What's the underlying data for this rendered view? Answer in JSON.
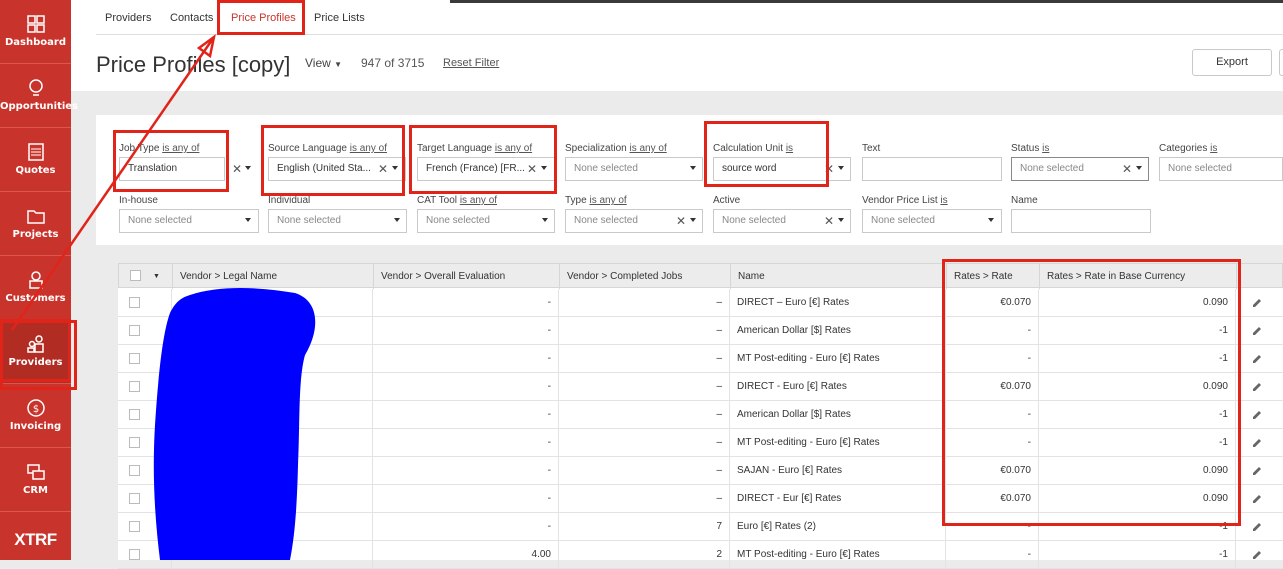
{
  "nav": {
    "items": [
      {
        "label": "Dashboard",
        "icon": "dashboard-icon"
      },
      {
        "label": "Opportunities",
        "icon": "lightbulb-icon"
      },
      {
        "label": "Quotes",
        "icon": "calculator-icon"
      },
      {
        "label": "Projects",
        "icon": "folder-icon"
      },
      {
        "label": "Customers",
        "icon": "customer-icon"
      },
      {
        "label": "Providers",
        "icon": "providers-icon"
      },
      {
        "label": "Invoicing",
        "icon": "dollar-coin-icon"
      },
      {
        "label": "CRM",
        "icon": "chat-bubbles-icon"
      }
    ],
    "logo": "XTRF"
  },
  "tabs": [
    "Providers",
    "Contacts",
    "Price Profiles",
    "Price Lists"
  ],
  "header": {
    "title": "Price Profiles [copy]",
    "view": "View",
    "count": "947 of 3715",
    "reset": "Reset Filter",
    "export": "Export"
  },
  "filters": {
    "job_type": {
      "label": "Job Type",
      "op": "is any of",
      "value": "Translation"
    },
    "source_language": {
      "label": "Source Language",
      "op": "is any of",
      "value": "English (United Sta..."
    },
    "target_language": {
      "label": "Target Language",
      "op": "is any of",
      "value": "French (France) [FR..."
    },
    "specialization": {
      "label": "Specialization",
      "op": "is any of",
      "value": "None selected"
    },
    "calculation_unit": {
      "label": "Calculation Unit",
      "op": "is",
      "value": "source word"
    },
    "text": {
      "label": "Text",
      "value": ""
    },
    "status": {
      "label": "Status",
      "op": "is",
      "value": "None selected"
    },
    "categories": {
      "label": "Categories",
      "op": "is",
      "value": "None selected"
    },
    "in_house": {
      "label": "In-house",
      "value": "None selected"
    },
    "individual": {
      "label": "Individual",
      "value": "None selected"
    },
    "cat_tool": {
      "label": "CAT Tool",
      "op": "is any of",
      "value": "None selected"
    },
    "type": {
      "label": "Type",
      "op": "is any of",
      "value": "None selected"
    },
    "active": {
      "label": "Active",
      "value": "None selected"
    },
    "vendor_price_list": {
      "label": "Vendor Price List",
      "op": "is",
      "value": "None selected"
    },
    "name": {
      "label": "Name",
      "value": ""
    }
  },
  "table": {
    "columns": [
      "Vendor > Legal Name",
      "Vendor > Overall Evaluation",
      "Vendor > Completed Jobs",
      "Name",
      "Rates > Rate",
      "Rates > Rate in Base Currency"
    ],
    "rows": [
      {
        "legal": "",
        "eval": "-",
        "jobs": "–",
        "name": "DIRECT – Euro [€] Rates",
        "rate": "€0.070",
        "base": "0.090"
      },
      {
        "legal": "",
        "eval": "-",
        "jobs": "–",
        "name": "American Dollar [$] Rates",
        "rate": "-",
        "base": "-1"
      },
      {
        "legal": "",
        "eval": "-",
        "jobs": "–",
        "name": "MT Post-editing - Euro [€] Rates",
        "rate": "-",
        "base": "-1"
      },
      {
        "legal": "",
        "eval": "-",
        "jobs": "–",
        "name": "DIRECT - Euro [€] Rates",
        "rate": "€0.070",
        "base": "0.090"
      },
      {
        "legal": "",
        "eval": "-",
        "jobs": "–",
        "name": "American Dollar [$] Rates",
        "rate": "-",
        "base": "-1"
      },
      {
        "legal": "",
        "eval": "-",
        "jobs": "–",
        "name": "MT Post-editing - Euro [€] Rates",
        "rate": "-",
        "base": "-1"
      },
      {
        "legal": "",
        "eval": "-",
        "jobs": "–",
        "name": "SAJAN - Euro [€] Rates",
        "rate": "€0.070",
        "base": "0.090"
      },
      {
        "legal": "",
        "eval": "-",
        "jobs": "–",
        "name": "DIRECT - Eur [€] Rates",
        "rate": "€0.070",
        "base": "0.090"
      },
      {
        "legal": "",
        "eval": "-",
        "jobs": "7",
        "name": "Euro [€] Rates (2)",
        "rate": "-",
        "base": "-1"
      },
      {
        "legal": "",
        "eval": "4.00",
        "jobs": "2",
        "name": "MT Post-editing - Euro [€] Rates",
        "rate": "-",
        "base": "-1"
      }
    ]
  },
  "colors": {
    "brand": "#c8342b",
    "annotation": "#e0241a",
    "redaction": "#0000ff"
  }
}
